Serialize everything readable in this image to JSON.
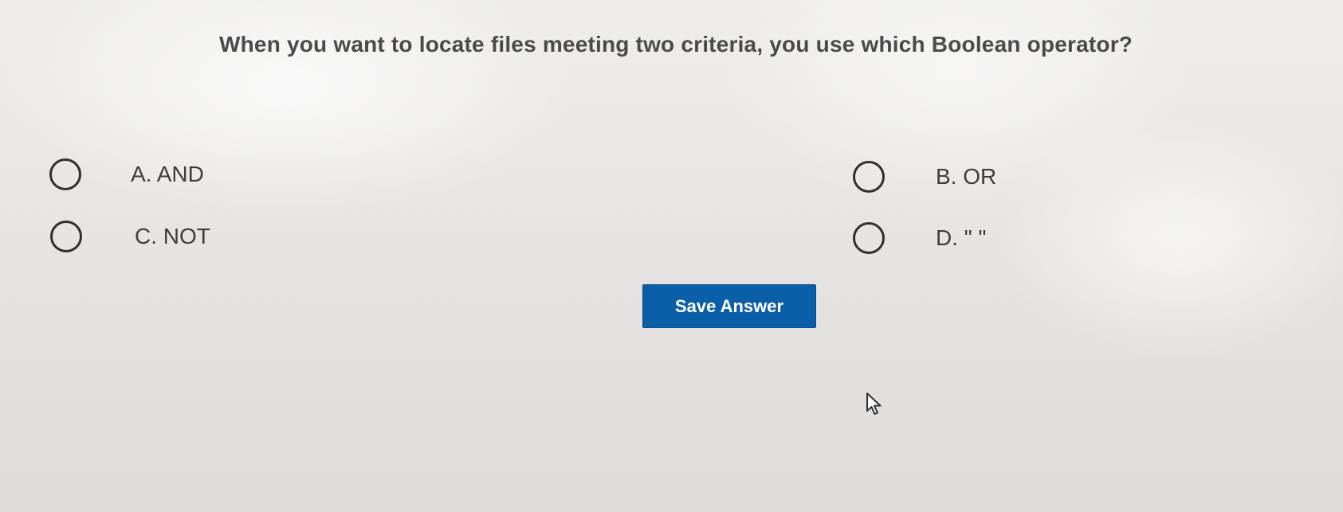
{
  "question": {
    "text": "When you want to locate files meeting two criteria, you use which Boolean operator?"
  },
  "options": [
    {
      "label": "A. AND",
      "selected": false
    },
    {
      "label": "B. OR",
      "selected": false
    },
    {
      "label": "C. NOT",
      "selected": false
    },
    {
      "label": "D. \" \"",
      "selected": false
    }
  ],
  "actions": {
    "save_label": "Save Answer"
  },
  "colors": {
    "accent": "#0b5ea8",
    "question_text": "#4a4a4a",
    "option_text": "#3d3d3d"
  },
  "icons": {
    "cursor": "mouse-pointer-icon",
    "radio": "radio-button-icon"
  }
}
